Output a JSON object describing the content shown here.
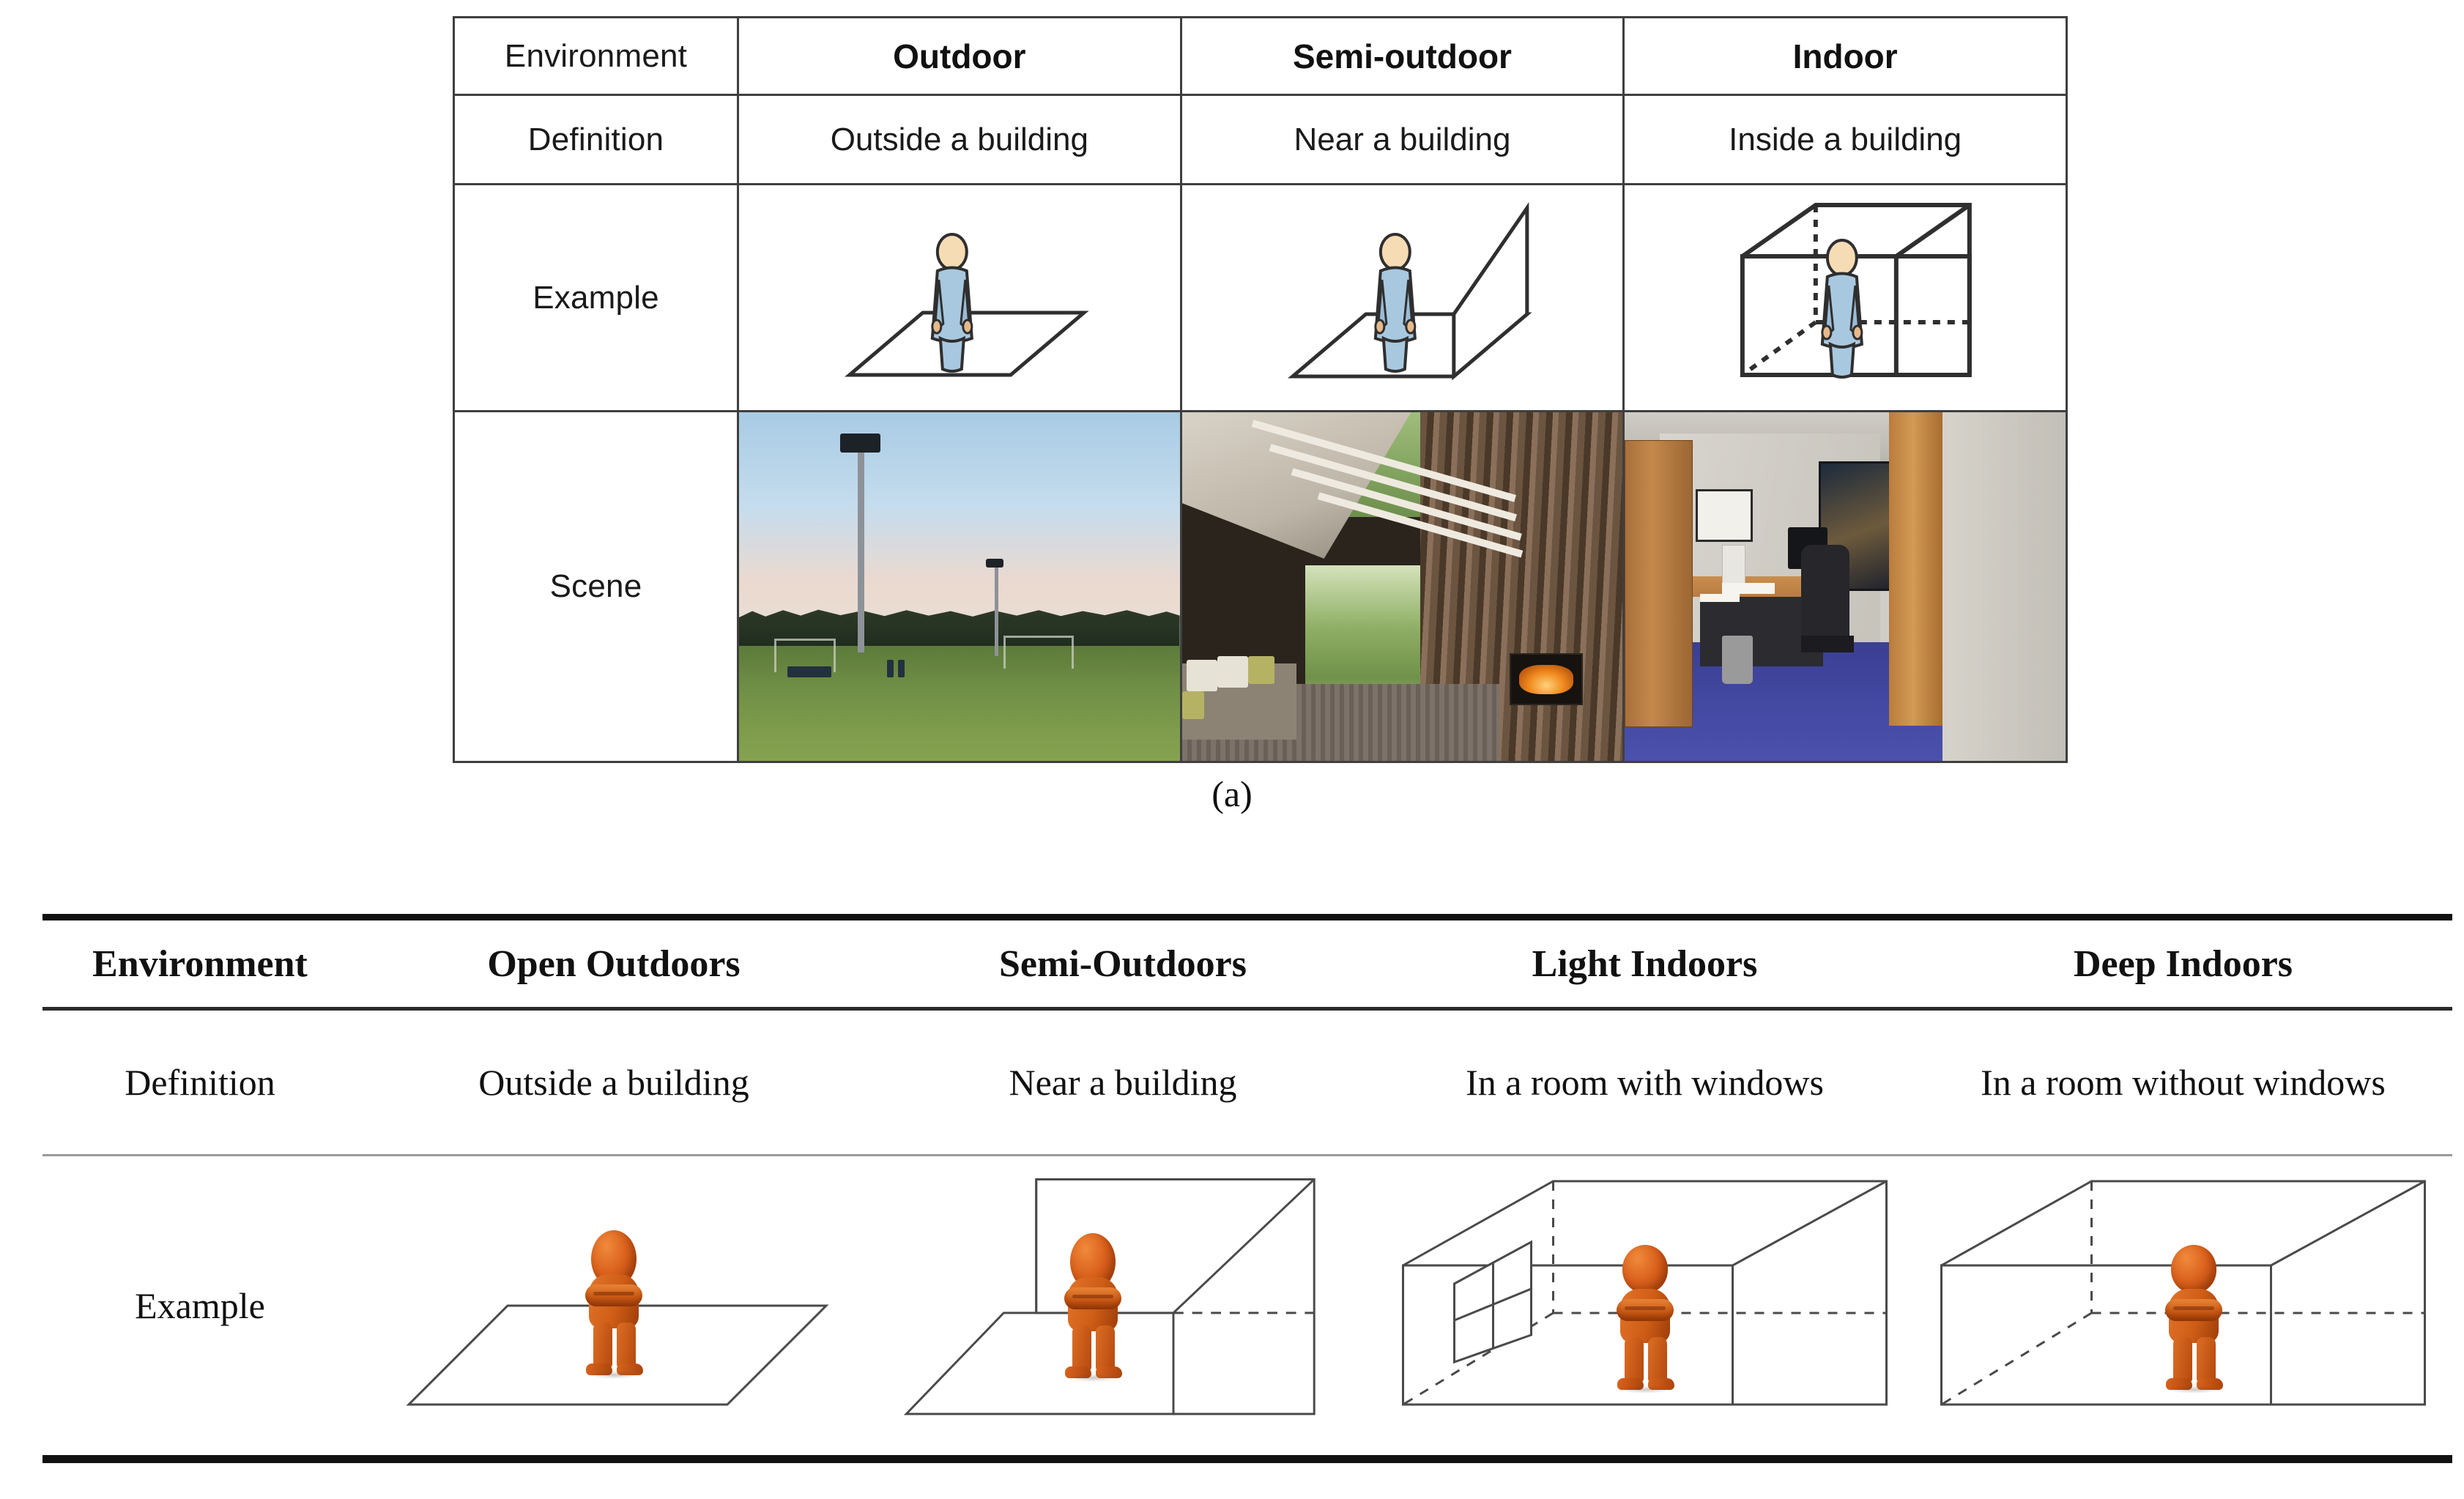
{
  "figure": {
    "caption_a": "(a)"
  },
  "table_a": {
    "row_labels": [
      "Environment",
      "Definition",
      "Example",
      "Scene"
    ],
    "headers": [
      "Environment",
      "Outdoor",
      "Semi-outdoor",
      "Indoor"
    ],
    "definitions": [
      "Definition",
      "Outside a building",
      "Near a building",
      "Inside a building"
    ],
    "example_label": "Example",
    "scene_label": "Scene",
    "examples": [
      {
        "name": "open-plane-with-person",
        "alt": "person standing on a flat ground plane"
      },
      {
        "name": "plane-with-wall-and-person",
        "alt": "person standing on a plane next to an upright wall"
      },
      {
        "name": "closed-box-with-person",
        "alt": "person standing inside a closed box"
      }
    ],
    "scenes": [
      {
        "name": "sports-field-at-dusk",
        "alt": "open grass sports field with floodlight poles and a treeline at dusk"
      },
      {
        "name": "covered-patio-with-fireplace",
        "alt": "timber-slatted covered patio open to greenery with a fireplace and bench seating"
      },
      {
        "name": "windowless-office-room",
        "alt": "office room with blue carpet, wooden cabinet, desk, chair and framed pictures"
      }
    ]
  },
  "table_b": {
    "headers": [
      "Environment",
      "Open Outdoors",
      "Semi-Outdoors",
      "Light Indoors",
      "Deep Indoors"
    ],
    "definition_label": "Definition",
    "definitions": [
      "Outside a building",
      "Near a building",
      "In a room with windows",
      "In a room without windows"
    ],
    "example_label": "Example",
    "examples": [
      {
        "name": "open-plane-with-figure",
        "alt": "orange figure standing on an open ground plane"
      },
      {
        "name": "plane-and-wall-with-figure",
        "alt": "orange figure standing on a plane beside a vertical wall panel"
      },
      {
        "name": "room-with-window-and-figure",
        "alt": "orange figure inside a wireframe room that has a window on the left wall"
      },
      {
        "name": "room-without-window-and-figure",
        "alt": "orange figure inside a wireframe room with no window"
      }
    ]
  },
  "colors": {
    "figure_orange": "#cf5d16",
    "person_blue": "#a8c8e0",
    "skin": "#f2d0a4",
    "rule_dark": "#111111",
    "cell_border": "#3f3f3f",
    "office_carpet": "#454bb0",
    "grass": "#7d9b4b",
    "sky": "#a8cbe4"
  }
}
